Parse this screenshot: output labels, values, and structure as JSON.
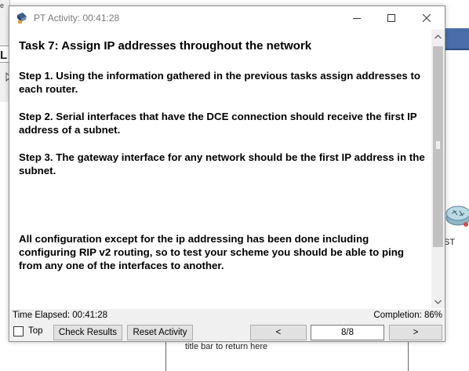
{
  "window": {
    "title": "PT Activity: 00:41:28",
    "icon": "packet-tracer-icon",
    "controls": [
      "minimize-icon",
      "maximize-icon",
      "close-icon"
    ]
  },
  "content": {
    "task_title": "Task 7: Assign IP addresses throughout the network",
    "paragraphs": [
      "Step 1. Using the information gathered in the previous tasks assign addresses to each router.",
      "Step 2. Serial interfaces that have the DCE connection should receive the first IP address of a subnet.",
      "Step 3. The gateway interface for any network should be the first IP address in the subnet.",
      "All configuration except for the ip addressing has been done including configuring RIP v2 routing, so to test your scheme you should be able to ping from any one of the interfaces to another."
    ]
  },
  "status": {
    "time_elapsed": "Time Elapsed: 00:41:28",
    "completion": "Completion: 86%"
  },
  "controls": {
    "top_checkbox_label": "Top",
    "top_checked": false,
    "check_results": "Check Results",
    "reset_activity": "Reset Activity",
    "prev": "<",
    "page": "8/8",
    "next": ">"
  },
  "background": {
    "left_fragment_e": "e",
    "left_fragment_L": "L",
    "right_fragment": "ST",
    "bottom_label": "title bar to return here"
  },
  "colors": {
    "accent_bar": "#4a6ea9",
    "scroll_thumb": "#c1c1c1"
  }
}
